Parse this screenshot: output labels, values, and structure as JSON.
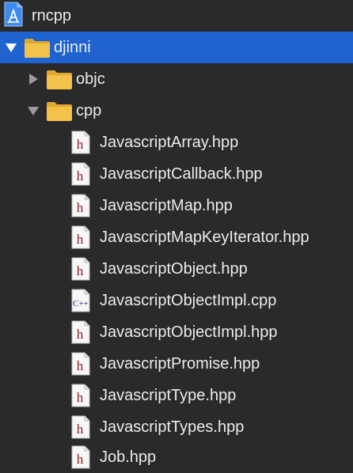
{
  "project": {
    "name": "rncpp",
    "icon": "xcode-project-icon"
  },
  "groups": {
    "djinni": {
      "label": "djinni",
      "expanded": true,
      "selected": true
    },
    "objc": {
      "label": "objc",
      "expanded": false
    },
    "cpp": {
      "label": "cpp",
      "expanded": true
    }
  },
  "files": [
    {
      "label": "JavascriptArray.hpp",
      "type": "h"
    },
    {
      "label": "JavascriptCallback.hpp",
      "type": "h"
    },
    {
      "label": "JavascriptMap.hpp",
      "type": "h"
    },
    {
      "label": "JavascriptMapKeyIterator.hpp",
      "type": "h"
    },
    {
      "label": "JavascriptObject.hpp",
      "type": "h"
    },
    {
      "label": "JavascriptObjectImpl.cpp",
      "type": "cpp"
    },
    {
      "label": "JavascriptObjectImpl.hpp",
      "type": "h"
    },
    {
      "label": "JavascriptPromise.hpp",
      "type": "h"
    },
    {
      "label": "JavascriptType.hpp",
      "type": "h"
    },
    {
      "label": "JavascriptTypes.hpp",
      "type": "h"
    },
    {
      "label": "Job.hpp",
      "type": "h"
    }
  ],
  "icons": {
    "header_glyph": "h",
    "cpp_glyph": "C++"
  },
  "colors": {
    "background": "#2b2a2b",
    "selection": "#1f63d0",
    "folder": "#f4c24a",
    "header_glyph": "#8b1a1a",
    "cpp_glyph": "#1f2a8a"
  }
}
